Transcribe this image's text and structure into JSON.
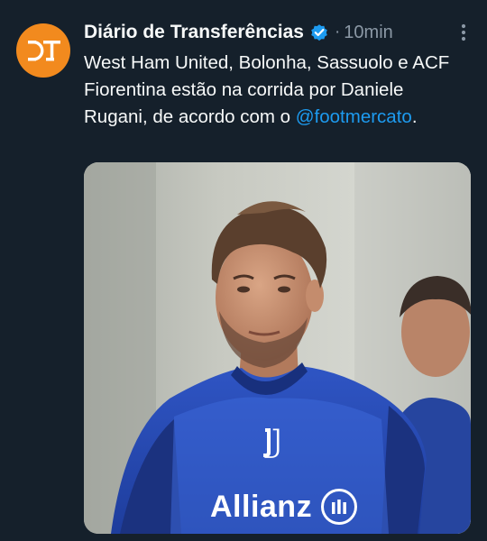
{
  "tweet": {
    "author_name": "Diário de Transferências",
    "separator": "·",
    "time": "10min",
    "text_before": "West Ham United, Bolonha, Sassuolo e ACF Fiorentina estão na corrida por Daniele Rugani, de acordo com o ",
    "mention": "@footmercato",
    "text_after": ".",
    "avatar_initials": "DT"
  },
  "media": {
    "shirt_sponsor": "Allianz"
  },
  "colors": {
    "background": "#15202b",
    "accent": "#1d9bf0",
    "avatar": "#f28a1e",
    "muted": "#8b98a5"
  },
  "icons": [
    "verified-badge-icon",
    "more-options-icon"
  ]
}
